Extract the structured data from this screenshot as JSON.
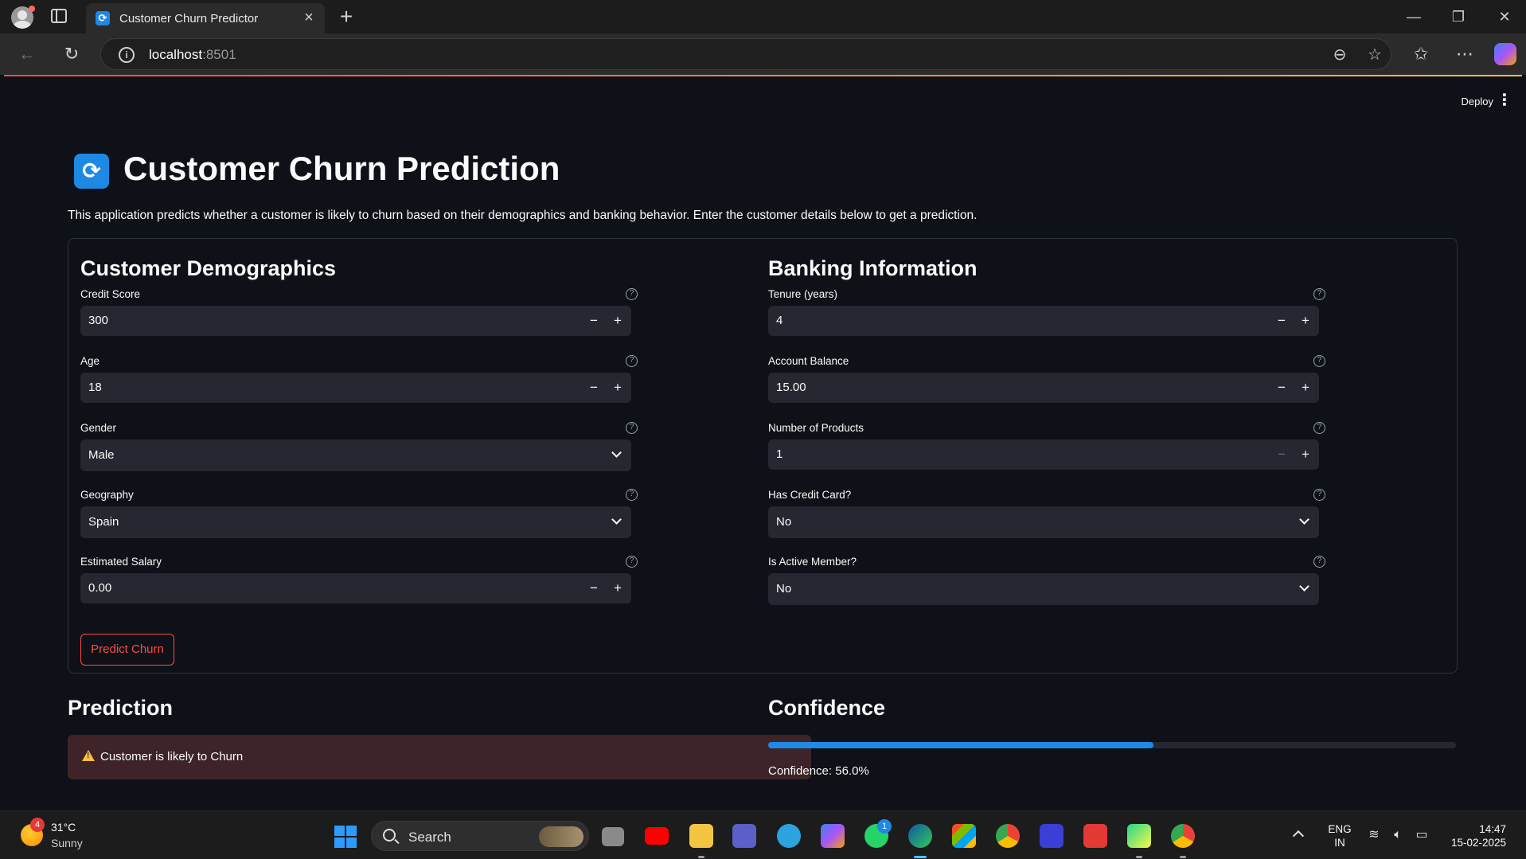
{
  "browser": {
    "tab_title": "Customer Churn Predictor",
    "url_host": "localhost",
    "url_port": ":8501"
  },
  "app": {
    "deploy_label": "Deploy",
    "title": "Customer Churn Prediction",
    "description": "This application predicts whether a customer is likely to churn based on their demographics and banking behavior. Enter the customer details below to get a prediction."
  },
  "form": {
    "demographics": {
      "header": "Customer Demographics",
      "credit_score": {
        "label": "Credit Score",
        "value": "300"
      },
      "age": {
        "label": "Age",
        "value": "18"
      },
      "gender": {
        "label": "Gender",
        "value": "Male"
      },
      "geography": {
        "label": "Geography",
        "value": "Spain"
      },
      "salary": {
        "label": "Estimated Salary",
        "value": "0.00"
      }
    },
    "banking": {
      "header": "Banking Information",
      "tenure": {
        "label": "Tenure (years)",
        "value": "4"
      },
      "balance": {
        "label": "Account Balance",
        "value": "15.00"
      },
      "products": {
        "label": "Number of Products",
        "value": "1"
      },
      "credit_card": {
        "label": "Has Credit Card?",
        "value": "No"
      },
      "active_member": {
        "label": "Is Active Member?",
        "value": "No"
      }
    },
    "submit_label": "Predict Churn"
  },
  "result": {
    "prediction_header": "Prediction",
    "prediction_text": "Customer is likely to Churn",
    "confidence_header": "Confidence",
    "confidence_value": 0.56,
    "confidence_text": "Confidence: 56.0%"
  },
  "taskbar": {
    "weather_badge": "4",
    "temperature": "31°C",
    "condition": "Sunny",
    "search_label": "Search",
    "whatsapp_badge": "1",
    "lang_line1": "ENG",
    "lang_line2": "IN",
    "time": "14:47",
    "date": "15-02-2025"
  },
  "colors": {
    "accent": "#ff4b4b",
    "progress": "#1f8ae6",
    "background": "#0e1117",
    "input_bg": "#262730"
  }
}
